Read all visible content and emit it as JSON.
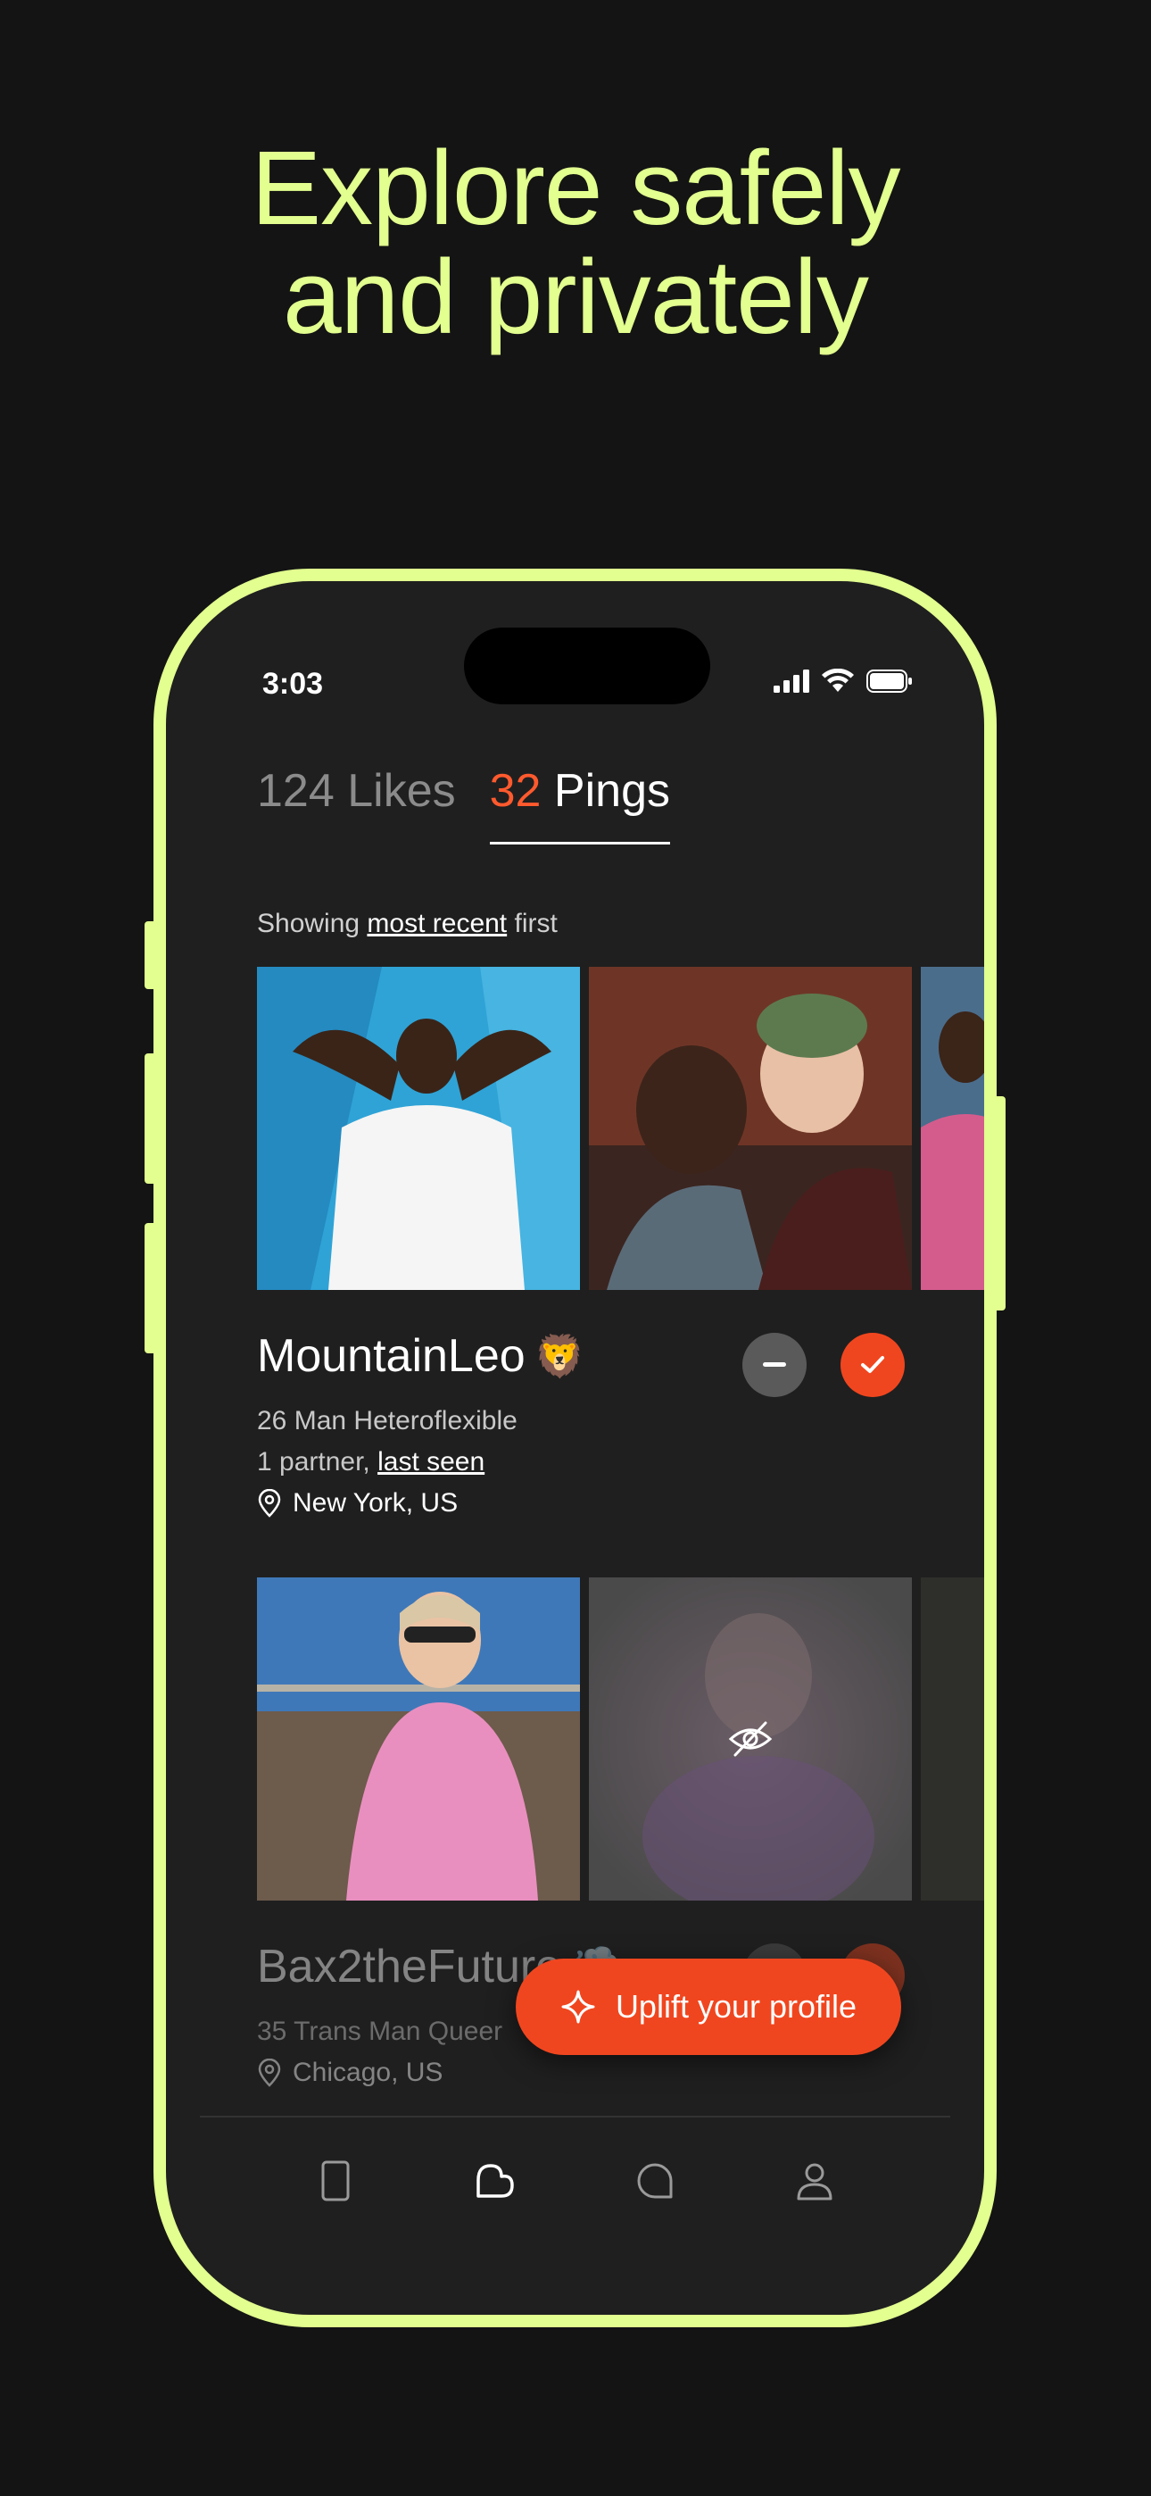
{
  "headline": {
    "line1": "Explore safely",
    "line2": "and privately"
  },
  "status_bar": {
    "time": "3:03"
  },
  "tabs": {
    "likes": {
      "count": "124",
      "label": "Likes"
    },
    "pings": {
      "count": "32",
      "label": "Pings"
    }
  },
  "sort": {
    "prefix": "Showing ",
    "link": "most recent",
    "suffix": " first"
  },
  "profiles": [
    {
      "name": "MountainLeo",
      "emoji": "🦁",
      "details": "26 Man Heteroflexible",
      "partners": "1 partner, ",
      "last_seen": "last seen",
      "location": "New York, US"
    },
    {
      "name": "Bax2theFuture",
      "emoji": "💨",
      "details": "35 Trans Man Queer",
      "location": "Chicago, US"
    }
  ],
  "cta": {
    "label": "Uplift your profile"
  },
  "nav": [
    "phone-icon",
    "likes-icon",
    "chat-icon",
    "profile-icon"
  ],
  "colors": {
    "accent": "#e2ff8f",
    "brand": "#f0461f",
    "background": "#141414"
  }
}
